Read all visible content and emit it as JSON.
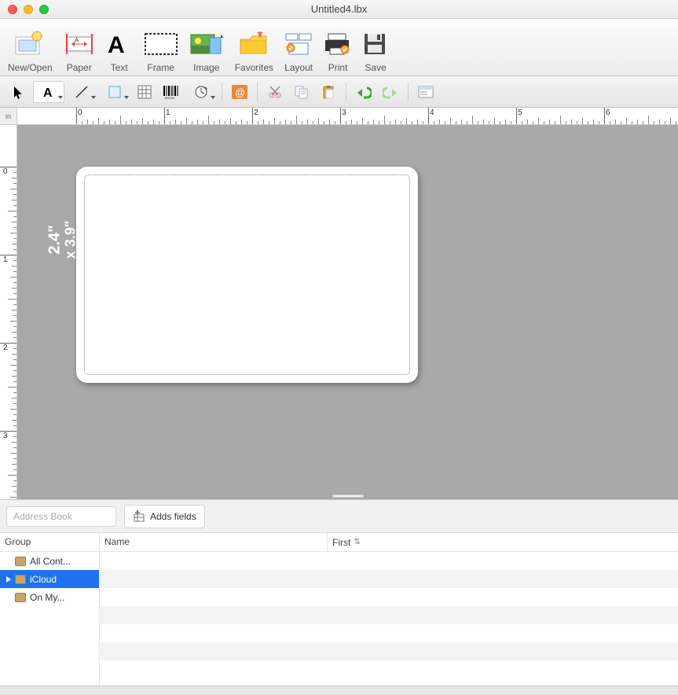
{
  "window": {
    "title": "Untitled4.lbx"
  },
  "toolbar": {
    "new_open": "New/Open",
    "paper": "Paper",
    "text": "Text",
    "frame": "Frame",
    "image": "Image",
    "favorites": "Favorites",
    "layout": "Layout",
    "print": "Print",
    "save": "Save"
  },
  "ruler": {
    "unit": "in",
    "h_marks": [
      "0",
      "1",
      "2",
      "3",
      "4",
      "5",
      "6"
    ],
    "v_marks": [
      "0",
      "1",
      "2",
      "3"
    ]
  },
  "label": {
    "height": "2.4\"",
    "width": "x 3.9\""
  },
  "addressbook": {
    "placeholder": "Address Book",
    "adds_fields": "Adds fields"
  },
  "columns": {
    "group": "Group",
    "name": "Name",
    "first": "First"
  },
  "groups": {
    "items": [
      {
        "label": "All Cont...",
        "selected": false,
        "expandable": false
      },
      {
        "label": "iCloud",
        "selected": true,
        "expandable": true
      },
      {
        "label": "On My...",
        "selected": false,
        "expandable": false
      }
    ]
  }
}
